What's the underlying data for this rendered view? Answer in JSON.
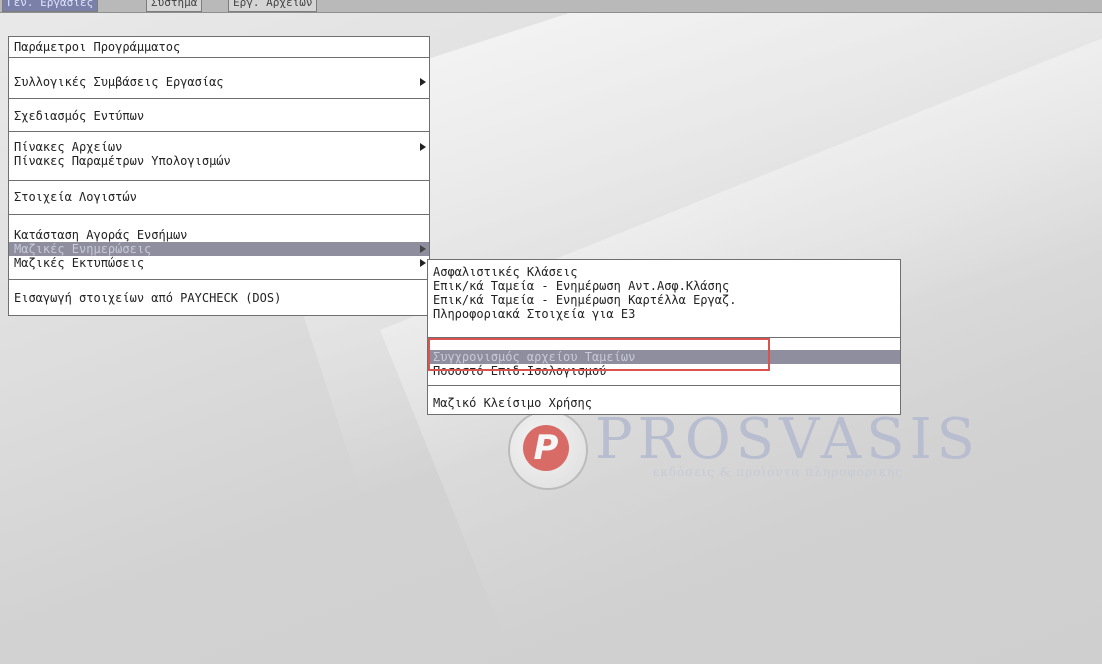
{
  "menubar": {
    "tabs": [
      "Γεν. Εργασίες",
      "Σύστημα",
      "Εργ. Αρχείων"
    ]
  },
  "main_menu": {
    "items": [
      {
        "label": "Παράμετροι Προγράμματος",
        "submenu": false
      },
      {
        "label": "Συλλογικές Συμβάσεις Εργασίας",
        "submenu": true
      },
      {
        "label": "Σχεδιασμός Εντύπων",
        "submenu": false
      },
      {
        "label": "Πίνακες Αρχείων",
        "submenu": true
      },
      {
        "label": "Πίνακες Παραμέτρων Υπολογισμών",
        "submenu": false
      },
      {
        "label": "Στοιχεία Λογιστών",
        "submenu": false
      },
      {
        "label": "Κατάσταση Αγοράς Ενσήμων",
        "submenu": false
      },
      {
        "label": "Μαζικές Ενημερώσεις",
        "submenu": true,
        "highlighted": true
      },
      {
        "label": "Μαζικές Εκτυπώσεις",
        "submenu": true
      },
      {
        "label": "Εισαγωγή στοιχείων από PAYCHECK (DOS)",
        "submenu": false
      }
    ]
  },
  "sub_menu": {
    "items": [
      {
        "label": "Ασφαλιστικές Κλάσεις"
      },
      {
        "label": "Επικ/κά Ταμεία - Ενημέρωση Αντ.Ασφ.Κλάσης"
      },
      {
        "label": "Επικ/κά Ταμεία - Ενημέρωση Καρτέλλα Εργαζ."
      },
      {
        "label": "Πληροφοριακά Στοιχεία για Ε3"
      },
      {
        "label": "Συγχρονισμός αρχείου Ταμείων",
        "highlighted": true
      },
      {
        "label": "Ποσοστό Επιδ.Ισολογισμού"
      },
      {
        "label": "Μαζικό Κλείσιμο Χρήσης"
      }
    ]
  },
  "logo": {
    "word": "PROSVASIS",
    "letter": "P",
    "tagline": "εκδόσεις & προϊόντα πληροφορικής"
  },
  "colors": {
    "highlight": "#8e8e9e",
    "annotation": "#d9534f",
    "logo_red": "#d86b66"
  }
}
